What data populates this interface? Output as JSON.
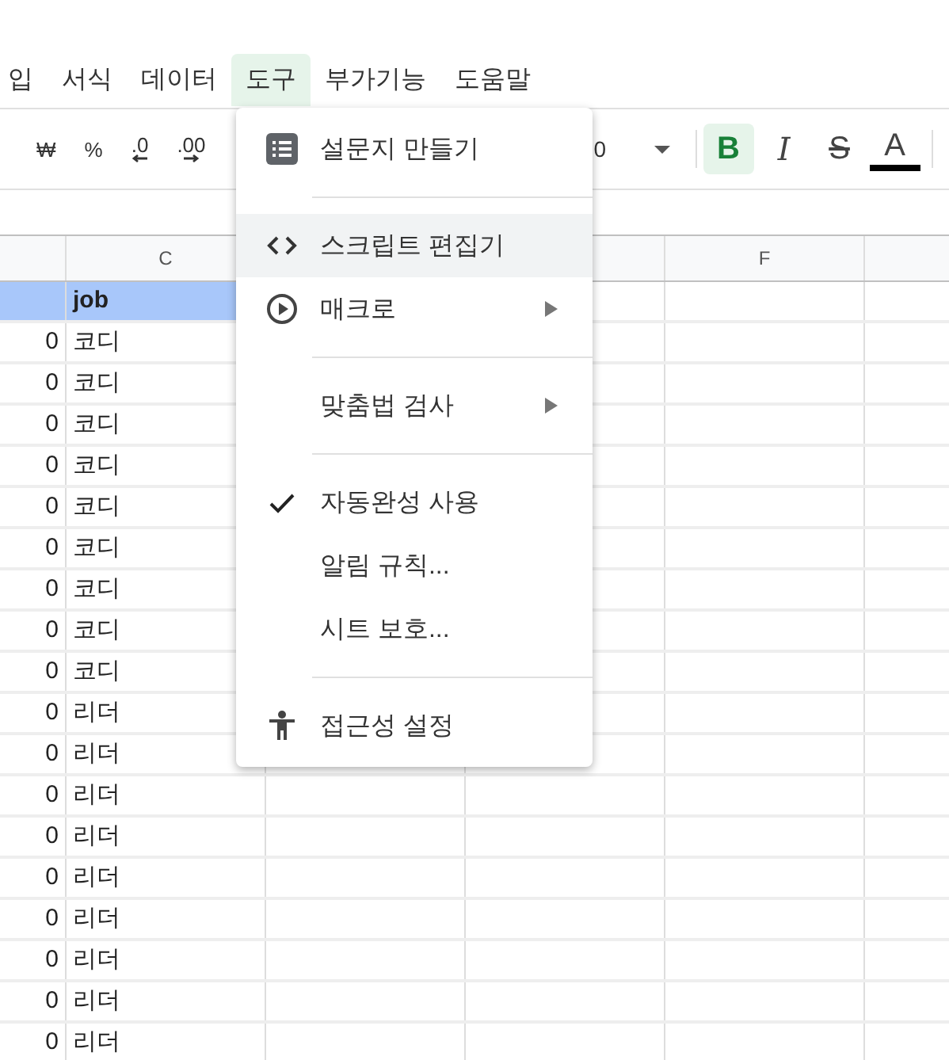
{
  "menu_bar": [
    {
      "label": "입",
      "selected": false
    },
    {
      "label": "서식",
      "selected": false
    },
    {
      "label": "데이터",
      "selected": false
    },
    {
      "label": "도구",
      "selected": true
    },
    {
      "label": "부가기능",
      "selected": false
    },
    {
      "label": "도움말",
      "selected": false
    }
  ],
  "toolbar": {
    "left": [
      {
        "kind": "text",
        "label": "₩"
      },
      {
        "kind": "text",
        "label": "%"
      },
      {
        "kind": "decimal-less",
        "label": ".0"
      },
      {
        "kind": "decimal-more",
        "label": ".00"
      }
    ],
    "font_size": "0",
    "format": [
      {
        "kind": "bold",
        "label": "B",
        "on": true
      },
      {
        "kind": "italic",
        "label": "I",
        "on": false
      },
      {
        "kind": "strike",
        "label": "S",
        "on": false
      },
      {
        "kind": "color",
        "label": "A",
        "on": false
      }
    ]
  },
  "column_headers": [
    "C",
    "F"
  ],
  "rows": [
    {
      "b": "",
      "c": "job",
      "selected": true
    },
    {
      "b": "0",
      "c": "코디",
      "selected": false
    },
    {
      "b": "0",
      "c": "코디",
      "selected": false
    },
    {
      "b": "0",
      "c": "코디",
      "selected": false
    },
    {
      "b": "0",
      "c": "코디",
      "selected": false
    },
    {
      "b": "0",
      "c": "코디",
      "selected": false
    },
    {
      "b": "0",
      "c": "코디",
      "selected": false
    },
    {
      "b": "0",
      "c": "코디",
      "selected": false
    },
    {
      "b": "0",
      "c": "코디",
      "selected": false
    },
    {
      "b": "0",
      "c": "코디",
      "selected": false
    },
    {
      "b": "0",
      "c": "리더",
      "selected": false
    },
    {
      "b": "0",
      "c": "리더",
      "selected": false
    },
    {
      "b": "0",
      "c": "리더",
      "selected": false
    },
    {
      "b": "0",
      "c": "리더",
      "selected": false
    },
    {
      "b": "0",
      "c": "리더",
      "selected": false
    },
    {
      "b": "0",
      "c": "리더",
      "selected": false
    },
    {
      "b": "0",
      "c": "리더",
      "selected": false
    },
    {
      "b": "0",
      "c": "리더",
      "selected": false
    },
    {
      "b": "0",
      "c": "리더",
      "selected": false
    }
  ],
  "dropdown": {
    "groups": [
      [
        {
          "label": "설문지 만들기",
          "kind": "form",
          "hovered": false,
          "submenu": false,
          "checked": false
        }
      ],
      [
        {
          "label": "스크립트 편집기",
          "kind": "script",
          "hovered": true,
          "submenu": false,
          "checked": false
        },
        {
          "label": "매크로",
          "kind": "macro",
          "hovered": false,
          "submenu": true,
          "checked": false
        }
      ],
      [
        {
          "label": "맞춤법 검사",
          "kind": "plain",
          "hovered": false,
          "submenu": true,
          "checked": false
        }
      ],
      [
        {
          "label": "자동완성 사용",
          "kind": "plain",
          "hovered": false,
          "submenu": false,
          "checked": true
        },
        {
          "label": "알림 규칙...",
          "kind": "plain",
          "hovered": false,
          "submenu": false,
          "checked": false
        },
        {
          "label": "시트 보호...",
          "kind": "plain",
          "hovered": false,
          "submenu": false,
          "checked": false
        }
      ],
      [
        {
          "label": "접근성 설정",
          "kind": "accessibility",
          "hovered": false,
          "submenu": false,
          "checked": false
        }
      ]
    ]
  }
}
